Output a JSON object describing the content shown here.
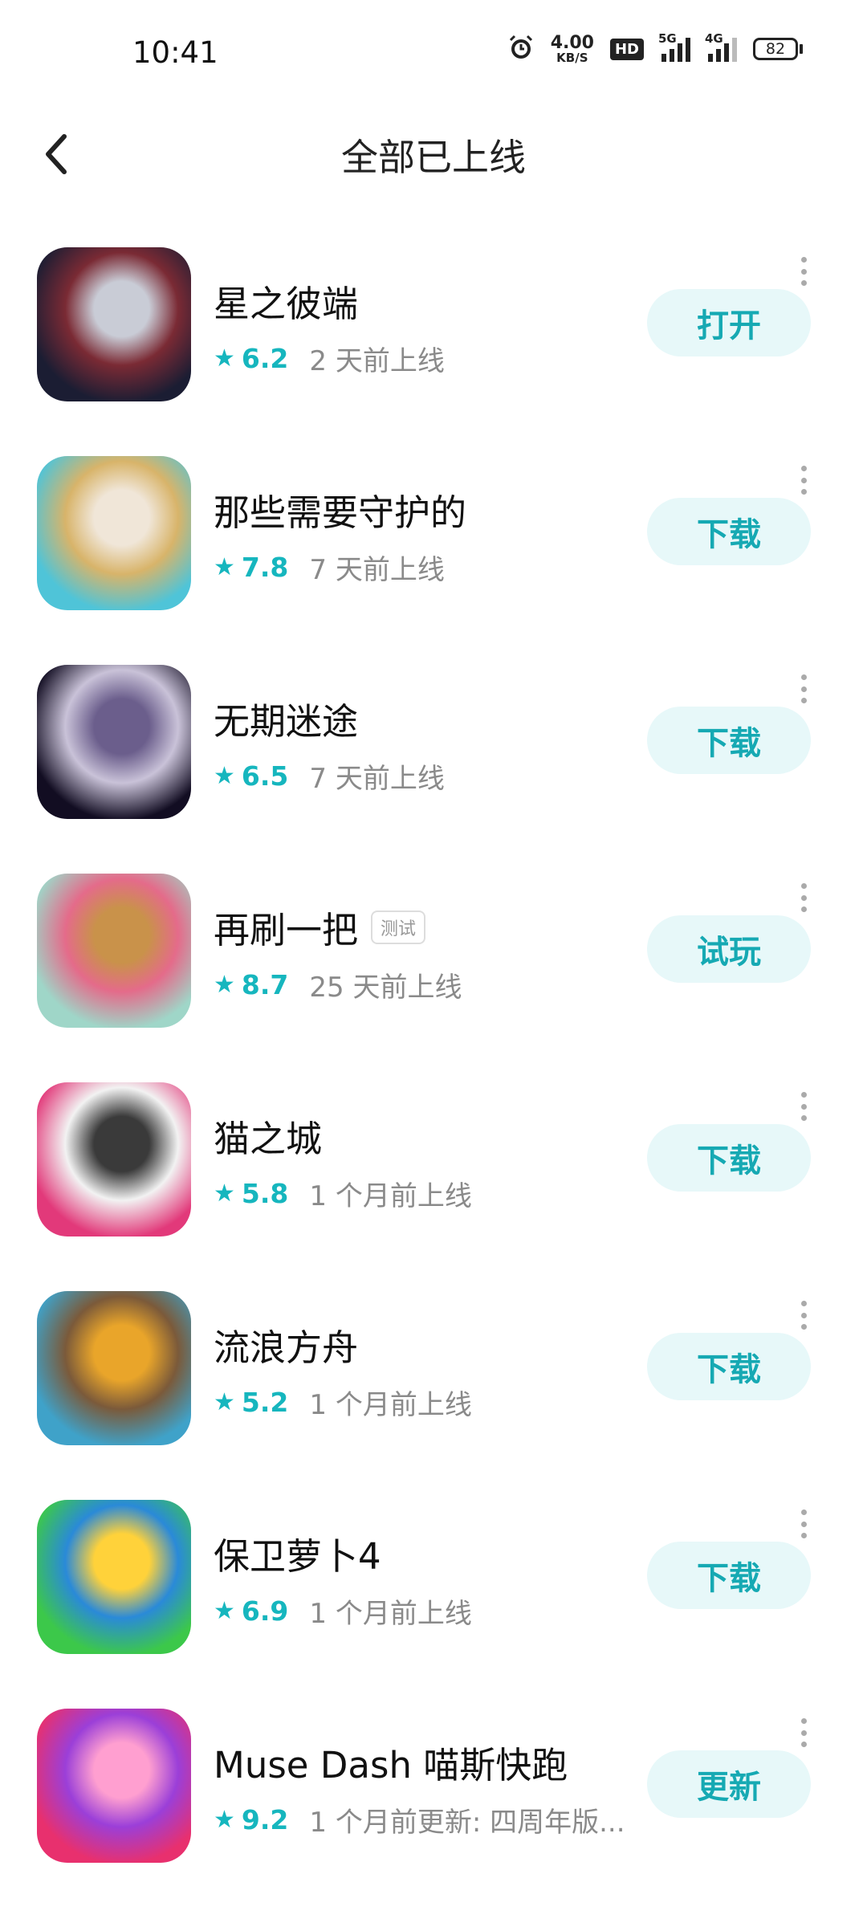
{
  "status_bar": {
    "time": "10:41",
    "net_speed_value": "4.00",
    "net_speed_unit": "KB/S",
    "hd_label": "HD",
    "signal1_label": "5G",
    "signal2_label": "4G",
    "battery": "82"
  },
  "header": {
    "title": "全部已上线"
  },
  "apps": [
    {
      "name": "星之彼端",
      "tag": "",
      "rating": "6.2",
      "when": "2 天前上线",
      "button": "打开",
      "icon_colors": [
        "#1b1d33",
        "#c9ccd6",
        "#7a2a34"
      ]
    },
    {
      "name": "那些需要守护的",
      "tag": "",
      "rating": "7.8",
      "when": "7 天前上线",
      "button": "下载",
      "icon_colors": [
        "#4fc4d8",
        "#f0e6d8",
        "#d8b46a"
      ]
    },
    {
      "name": "无期迷途",
      "tag": "",
      "rating": "6.5",
      "when": "7 天前上线",
      "button": "下载",
      "icon_colors": [
        "#120d22",
        "#6b5e8c",
        "#c9c2d8"
      ]
    },
    {
      "name": "再刷一把",
      "tag": "测试",
      "rating": "8.7",
      "when": "25 天前上线",
      "button": "试玩",
      "icon_colors": [
        "#9fd6c8",
        "#c9924a",
        "#e46b8a"
      ]
    },
    {
      "name": "猫之城",
      "tag": "",
      "rating": "5.8",
      "when": "1 个月前上线",
      "button": "下载",
      "icon_colors": [
        "#e2397a",
        "#3a3a3a",
        "#f2f2f2"
      ]
    },
    {
      "name": "流浪方舟",
      "tag": "",
      "rating": "5.2",
      "when": "1 个月前上线",
      "button": "下载",
      "icon_colors": [
        "#3fa2c9",
        "#e9a52a",
        "#7b5a3a"
      ]
    },
    {
      "name": "保卫萝卜4",
      "tag": "",
      "rating": "6.9",
      "when": "1 个月前上线",
      "button": "下载",
      "icon_colors": [
        "#3cc84a",
        "#ffd23a",
        "#2a8ad8"
      ]
    },
    {
      "name": "Muse Dash 喵斯快跑",
      "tag": "",
      "rating": "9.2",
      "when": "1 个月前更新: 四周年版...",
      "button": "更新",
      "icon_colors": [
        "#e8306e",
        "#ff9fd0",
        "#9b3fd8"
      ]
    }
  ]
}
